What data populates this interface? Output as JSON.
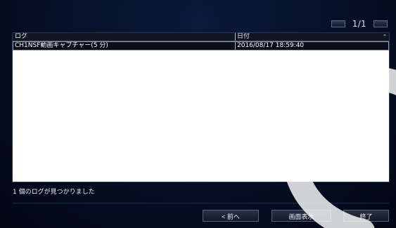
{
  "pager": {
    "text": "1/1"
  },
  "table": {
    "headers": {
      "log": "ログ",
      "date": "日付"
    },
    "rows": [
      {
        "log": "CH1NSF動画キャプチャー(5 分)",
        "date": "2016/08/17 18:59:40"
      }
    ]
  },
  "status": {
    "message": "1 個のログが見つかりました"
  },
  "buttons": {
    "previous": "< 前へ",
    "display": "画面表示",
    "close": "終了"
  },
  "colors": {
    "background": "#07112a",
    "table_bg": "#ffffff",
    "header_bg": "#111722",
    "row_bg": "#0a0d13"
  },
  "icons": {
    "sort": "sort-toggle-icon",
    "pager_prev": "page-prev-icon",
    "pager_next": "page-next-icon"
  }
}
